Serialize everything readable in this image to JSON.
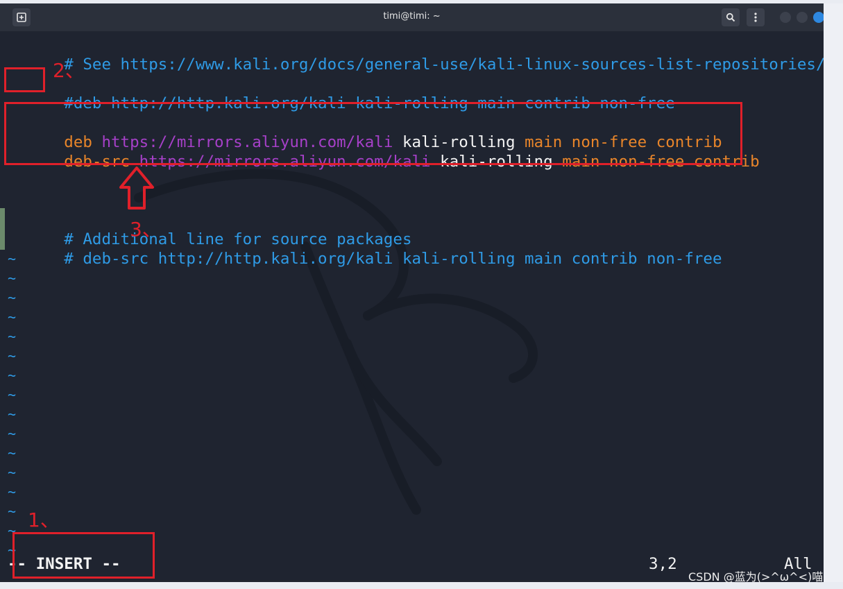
{
  "window": {
    "title": "timi@timi: ~"
  },
  "editor": {
    "lines": [
      {
        "segments": [
          {
            "text": "# See https://www.kali.org/docs/general-use/kali-linux-sources-list-repositories/",
            "color": "blue"
          }
        ]
      },
      {
        "segments": [
          {
            "text": "#deb http://http.kali.org/kali kali-rolling main contrib non-free",
            "color": "blue"
          }
        ]
      },
      {
        "segments": [
          {
            "text": "deb ",
            "color": "orange"
          },
          {
            "text": "https://mirrors.aliyun.com/kali",
            "color": "purple"
          },
          {
            "text": " kali-rolling ",
            "color": "white"
          },
          {
            "text": "main non-free contrib",
            "color": "orange"
          }
        ]
      },
      {
        "segments": [
          {
            "text": "deb-src ",
            "color": "orange"
          },
          {
            "text": "https://mirrors.aliyun.com/kali",
            "color": "purple"
          },
          {
            "text": " kali-rolling ",
            "color": "white"
          },
          {
            "text": "main non-free contrib",
            "color": "orange"
          }
        ]
      },
      {
        "segments": [
          {
            "text": "# Additional line for source packages",
            "color": "blue"
          }
        ]
      },
      {
        "segments": [
          {
            "text": "# deb-src http://http.kali.org/kali kali-rolling main contrib non-free",
            "color": "blue"
          }
        ]
      }
    ],
    "tilde": "~",
    "mode": "-- INSERT --",
    "cursor_pos": "3,2",
    "scroll_pos": "All"
  },
  "annotations": {
    "label_1": "1、",
    "label_2": "2、",
    "label_3": "3、"
  },
  "watermark": "CSDN @蓝为(>^ω^<)喵",
  "icons": {
    "new_tab": "new-tab-icon",
    "search": "search-icon",
    "menu": "kebab-menu-icon"
  },
  "colors": {
    "blue": "#2f9be6",
    "orange": "#e8852a",
    "purple": "#a640c8",
    "white": "#f3f3f3",
    "annotation_red": "#e0202a"
  }
}
